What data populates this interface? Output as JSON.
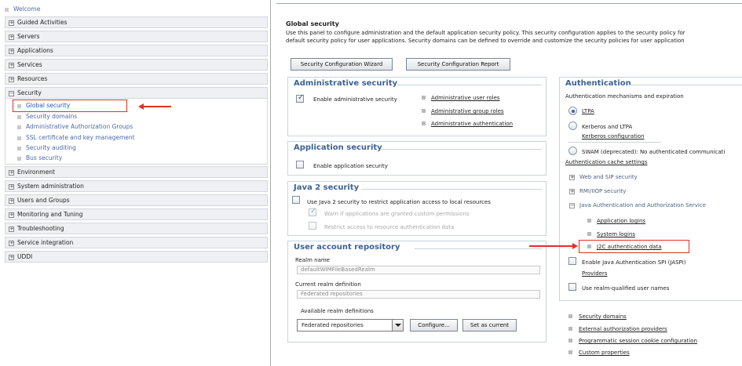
{
  "nav": {
    "welcome": "Welcome",
    "sections": [
      {
        "label": "Guided Activities",
        "expanded": false
      },
      {
        "label": "Servers",
        "expanded": false
      },
      {
        "label": "Applications",
        "expanded": false
      },
      {
        "label": "Services",
        "expanded": false
      },
      {
        "label": "Resources",
        "expanded": false
      },
      {
        "label": "Security",
        "expanded": true
      },
      {
        "label": "Environment",
        "expanded": false
      },
      {
        "label": "System administration",
        "expanded": false
      },
      {
        "label": "Users and Groups",
        "expanded": false
      },
      {
        "label": "Monitoring and Tuning",
        "expanded": false
      },
      {
        "label": "Troubleshooting",
        "expanded": false
      },
      {
        "label": "Service integration",
        "expanded": false
      },
      {
        "label": "UDDI",
        "expanded": false
      }
    ],
    "security_items": [
      "Global security",
      "Security domains",
      "Administrative Authorization Groups",
      "SSL certificate and key management",
      "Security auditing",
      "Bus security"
    ],
    "selected": "Global security",
    "expand_symbol": "+",
    "collapse_symbol": "−"
  },
  "main": {
    "title": "Global security",
    "description_line1": "Use this panel to configure administration and the default application security policy. This security configuration applies to the security policy for",
    "description_line2": "default security policy for user applications. Security domains can be defined to override and customize the security policies for user application",
    "buttons": {
      "wizard": "Security Configuration Wizard",
      "report": "Security Configuration Report"
    },
    "admin_security": {
      "title": "Administrative security",
      "checkbox_label": "Enable administrative security",
      "checked": true,
      "links": [
        "Administrative user roles",
        "Administrative group roles",
        "Administrative authentication"
      ]
    },
    "app_security": {
      "title": "Application security",
      "checkbox_label": "Enable application security",
      "checked": false
    },
    "java2_security": {
      "title": "Java 2 security",
      "main_label": "Use Java 2 security to restrict application access to local resources",
      "warn_label": "Warn if applications are granted custom permissions",
      "restrict_label": "Restrict access to resource authentication data"
    },
    "user_registry": {
      "title": "User account repository",
      "realm_name_label": "Realm name",
      "realm_name_value": "defaultWIMFileBasedRealm",
      "current_realm_label": "Current realm definition",
      "current_realm_value": "Federated repositories",
      "available_label": "Available realm definitions",
      "available_selected": "Federated repositories",
      "configure_button": "Configure...",
      "set_current_button": "Set as current"
    },
    "authentication": {
      "title": "Authentication",
      "mechanisms_label": "Authentication mechanisms and expiration",
      "ltpa": "LTPA",
      "kerberos_ltpa": "Kerberos and LTPA",
      "kerberos_config": "Kerberos configuration",
      "swam": "SWAM (deprecated): No authenticated communicati",
      "cache_settings": "Authentication cache settings",
      "web_sip": "Web and SIP security",
      "rmi_iiop": "RMI/IIOP security",
      "jaas": "Java Authentication and Authorization Service",
      "jaas_items": [
        "Application logins",
        "System logins",
        "J2C authentication data"
      ],
      "jaspi_label": "Enable Java Authentication SPI (JASPI)",
      "providers": "Providers",
      "realm_qualified": "Use realm-qualified user names"
    },
    "related_links": [
      "Security domains",
      "External authorization providers",
      "Programmatic session cookie configuration",
      "Custom properties"
    ]
  },
  "colors": {
    "accent_red": "#e0302a",
    "panel_title": "#3d6294",
    "link": "#2a57b0"
  }
}
